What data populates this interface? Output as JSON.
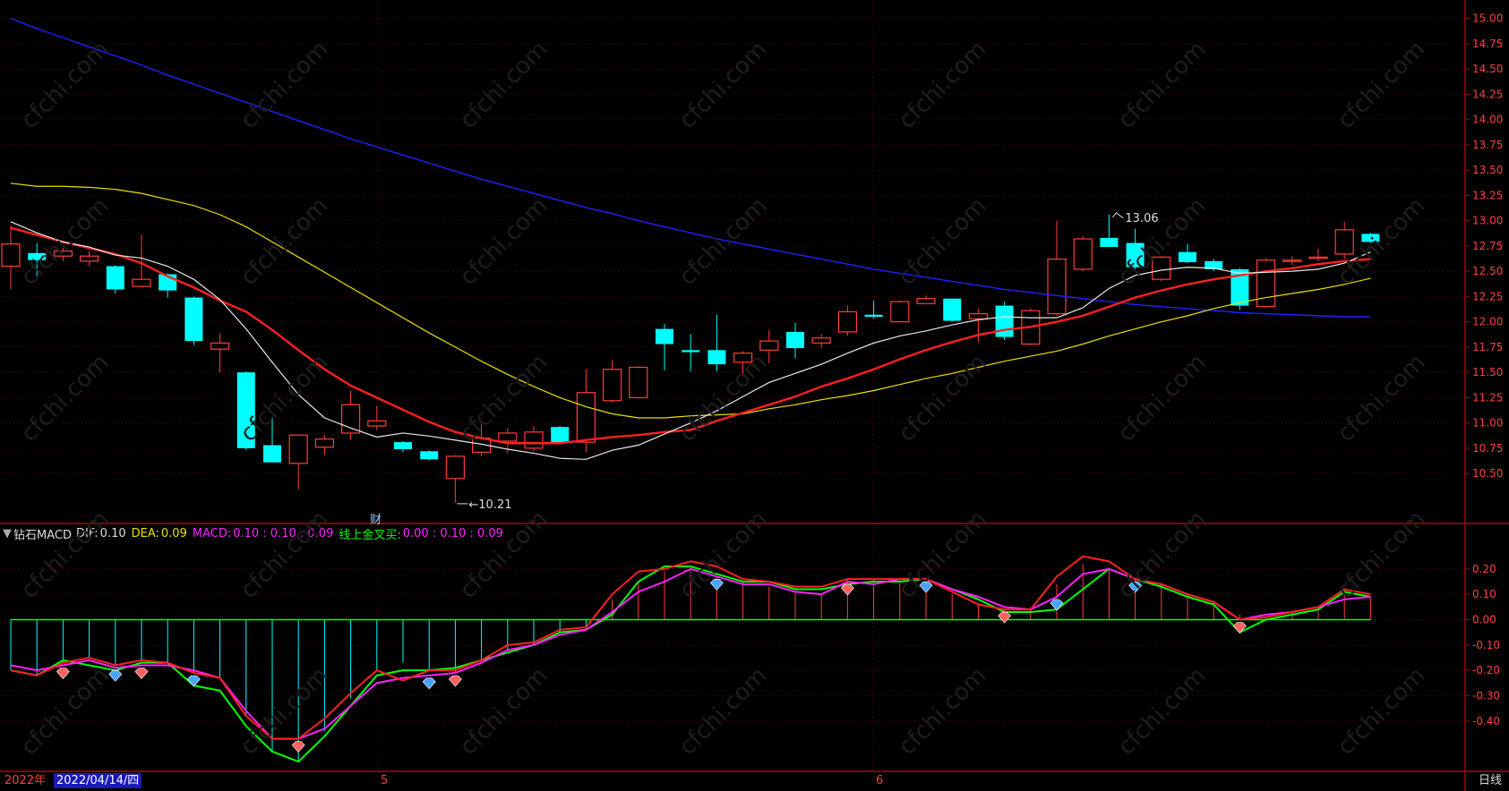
{
  "period_label": "日线",
  "year_label": "2022年",
  "cursor_date": "2022/04/14/四",
  "month_labels": [
    "5",
    "6"
  ],
  "finance_marker": "财",
  "watermark": "cfchi.com",
  "indicator": {
    "name": "钻石MACD",
    "dif_label": "DIF:",
    "dif_value": "0.10",
    "dea_label": "DEA:",
    "dea_value": "0.09",
    "macd_label": "MACD:",
    "macd_value": "0.10 : 0.10 : 0.09",
    "cross_label": "线上金叉买:",
    "cross_value": "0.00 : 0.10 : 0.09"
  },
  "colors": {
    "up": "#ff3c3c",
    "down": "#00ffff",
    "ma_fast": "#e8e8e8",
    "ma_mid": "#ff2020",
    "ma_slow": "#e8e000",
    "ma_long": "#2020ff",
    "dif": "#ff2020",
    "dea": "#ff20ff",
    "green": "#00ff00",
    "axis": "#b00000"
  },
  "chart_data": [
    {
      "type": "candlestick",
      "title": "",
      "y_ticks": [
        10.5,
        10.75,
        11.0,
        11.25,
        11.5,
        11.75,
        12.0,
        12.25,
        12.5,
        12.75,
        13.0,
        13.25,
        13.5,
        13.75,
        14.0,
        14.25,
        14.5,
        14.75,
        15.0
      ],
      "y_tick_labels": [
        "10.50",
        "10.75",
        "11.00",
        "11.25",
        "11.50",
        "11.75",
        "12.00",
        "12.25",
        "12.50",
        "12.75",
        "13.00",
        "13.25",
        "13.50",
        "13.75",
        "14.00",
        "14.25",
        "14.50",
        "14.75",
        "15.00"
      ],
      "ylim": [
        10.05,
        15.05
      ],
      "annotations": [
        {
          "text": "13.06",
          "index": 42,
          "value": 13.06
        },
        {
          "text": "10.21",
          "index": 17,
          "value": 10.21
        }
      ],
      "candles": [
        {
          "o": 12.55,
          "h": 12.95,
          "l": 12.32,
          "c": 12.77
        },
        {
          "o": 12.68,
          "h": 12.78,
          "l": 12.45,
          "c": 12.61
        },
        {
          "o": 12.65,
          "h": 12.73,
          "l": 12.6,
          "c": 12.7
        },
        {
          "o": 12.6,
          "h": 12.7,
          "l": 12.55,
          "c": 12.65
        },
        {
          "o": 12.55,
          "h": 12.56,
          "l": 12.28,
          "c": 12.32
        },
        {
          "o": 12.35,
          "h": 12.86,
          "l": 12.34,
          "c": 12.42
        },
        {
          "o": 12.47,
          "h": 12.48,
          "l": 12.24,
          "c": 12.31
        },
        {
          "o": 12.24,
          "h": 12.25,
          "l": 11.77,
          "c": 11.81
        },
        {
          "o": 11.73,
          "h": 11.89,
          "l": 11.5,
          "c": 11.79
        },
        {
          "o": 11.5,
          "h": 11.51,
          "l": 10.73,
          "c": 10.75
        },
        {
          "o": 10.78,
          "h": 11.05,
          "l": 10.61,
          "c": 10.61
        },
        {
          "o": 10.6,
          "h": 10.88,
          "l": 10.34,
          "c": 10.88
        },
        {
          "o": 10.76,
          "h": 10.88,
          "l": 10.68,
          "c": 10.84
        },
        {
          "o": 10.9,
          "h": 11.32,
          "l": 10.83,
          "c": 11.18
        },
        {
          "o": 10.97,
          "h": 11.17,
          "l": 10.93,
          "c": 11.02
        },
        {
          "o": 10.81,
          "h": 10.82,
          "l": 10.71,
          "c": 10.74
        },
        {
          "o": 10.72,
          "h": 10.73,
          "l": 10.63,
          "c": 10.64
        },
        {
          "o": 10.45,
          "h": 10.68,
          "l": 10.21,
          "c": 10.67
        },
        {
          "o": 10.71,
          "h": 10.99,
          "l": 10.67,
          "c": 10.85
        },
        {
          "o": 10.82,
          "h": 10.95,
          "l": 10.7,
          "c": 10.9
        },
        {
          "o": 10.75,
          "h": 10.97,
          "l": 10.72,
          "c": 10.91
        },
        {
          "o": 10.96,
          "h": 10.97,
          "l": 10.79,
          "c": 10.8
        },
        {
          "o": 10.81,
          "h": 11.53,
          "l": 10.71,
          "c": 11.3
        },
        {
          "o": 11.22,
          "h": 11.62,
          "l": 11.2,
          "c": 11.53
        },
        {
          "o": 11.25,
          "h": 11.56,
          "l": 11.24,
          "c": 11.55
        },
        {
          "o": 11.93,
          "h": 11.98,
          "l": 11.52,
          "c": 11.78
        },
        {
          "o": 11.72,
          "h": 11.88,
          "l": 11.51,
          "c": 11.7
        },
        {
          "o": 11.72,
          "h": 12.07,
          "l": 11.51,
          "c": 11.58
        },
        {
          "o": 11.6,
          "h": 11.71,
          "l": 11.47,
          "c": 11.69
        },
        {
          "o": 11.72,
          "h": 11.92,
          "l": 11.59,
          "c": 11.81
        },
        {
          "o": 11.9,
          "h": 11.99,
          "l": 11.64,
          "c": 11.74
        },
        {
          "o": 11.79,
          "h": 11.88,
          "l": 11.74,
          "c": 11.84
        },
        {
          "o": 11.9,
          "h": 12.16,
          "l": 11.86,
          "c": 12.1
        },
        {
          "o": 12.07,
          "h": 12.21,
          "l": 12.03,
          "c": 12.05
        },
        {
          "o": 12.0,
          "h": 12.21,
          "l": 12.0,
          "c": 12.2
        },
        {
          "o": 12.18,
          "h": 12.26,
          "l": 12.18,
          "c": 12.23
        },
        {
          "o": 12.23,
          "h": 12.23,
          "l": 12.0,
          "c": 12.01
        },
        {
          "o": 12.03,
          "h": 12.13,
          "l": 11.8,
          "c": 12.08
        },
        {
          "o": 12.16,
          "h": 12.2,
          "l": 11.82,
          "c": 11.85
        },
        {
          "o": 11.78,
          "h": 12.13,
          "l": 11.77,
          "c": 12.11
        },
        {
          "o": 12.08,
          "h": 13.0,
          "l": 12.06,
          "c": 12.62
        },
        {
          "o": 12.52,
          "h": 12.85,
          "l": 12.5,
          "c": 12.82
        },
        {
          "o": 12.83,
          "h": 13.06,
          "l": 12.74,
          "c": 12.74
        },
        {
          "o": 12.78,
          "h": 12.92,
          "l": 12.52,
          "c": 12.54
        },
        {
          "o": 12.42,
          "h": 12.65,
          "l": 12.4,
          "c": 12.64
        },
        {
          "o": 12.69,
          "h": 12.77,
          "l": 12.58,
          "c": 12.59
        },
        {
          "o": 12.6,
          "h": 12.62,
          "l": 12.5,
          "c": 12.52
        },
        {
          "o": 12.52,
          "h": 12.53,
          "l": 12.12,
          "c": 12.16
        },
        {
          "o": 12.15,
          "h": 12.63,
          "l": 12.14,
          "c": 12.61
        },
        {
          "o": 12.6,
          "h": 12.65,
          "l": 12.56,
          "c": 12.61
        },
        {
          "o": 12.64,
          "h": 12.72,
          "l": 12.6,
          "c": 12.64
        },
        {
          "o": 12.67,
          "h": 12.99,
          "l": 12.62,
          "c": 12.91
        },
        {
          "o": 12.87,
          "h": 12.88,
          "l": 12.78,
          "c": 12.79
        }
      ],
      "ma_fast": [
        12.99,
        12.88,
        12.79,
        12.74,
        12.66,
        12.63,
        12.55,
        12.42,
        12.22,
        11.93,
        11.6,
        11.28,
        11.05,
        10.95,
        10.86,
        10.9,
        10.87,
        10.83,
        10.79,
        10.74,
        10.7,
        10.65,
        10.64,
        10.73,
        10.78,
        10.89,
        11.0,
        11.12,
        11.26,
        11.4,
        11.49,
        11.58,
        11.69,
        11.79,
        11.86,
        11.91,
        11.97,
        12.02,
        12.05,
        12.04,
        12.04,
        12.14,
        12.33,
        12.46,
        12.51,
        12.54,
        12.53,
        12.48,
        12.49,
        12.5,
        12.52,
        12.58,
        12.69
      ],
      "ma_mid": [
        12.93,
        12.86,
        12.79,
        12.73,
        12.67,
        12.58,
        12.45,
        12.34,
        12.21,
        12.1,
        11.92,
        11.72,
        11.53,
        11.37,
        11.25,
        11.13,
        11.01,
        10.91,
        10.85,
        10.8,
        10.8,
        10.8,
        10.83,
        10.86,
        10.88,
        10.91,
        10.93,
        11.02,
        11.1,
        11.18,
        11.26,
        11.36,
        11.44,
        11.53,
        11.63,
        11.72,
        11.8,
        11.87,
        11.92,
        11.95,
        12.0,
        12.06,
        12.15,
        12.24,
        12.31,
        12.37,
        12.42,
        12.46,
        12.5,
        12.53,
        12.57,
        12.6,
        12.62
      ],
      "ma_slow": [
        13.37,
        13.34,
        13.34,
        13.33,
        13.31,
        13.27,
        13.21,
        13.15,
        13.06,
        12.94,
        12.79,
        12.64,
        12.49,
        12.34,
        12.19,
        12.04,
        11.89,
        11.75,
        11.61,
        11.48,
        11.36,
        11.25,
        11.16,
        11.09,
        11.05,
        11.05,
        11.07,
        11.08,
        11.09,
        11.14,
        11.18,
        11.23,
        11.27,
        11.32,
        11.38,
        11.44,
        11.49,
        11.55,
        11.61,
        11.66,
        11.71,
        11.78,
        11.86,
        11.93,
        12.0,
        12.06,
        12.13,
        12.19,
        12.24,
        12.28,
        12.32,
        12.37,
        12.43
      ],
      "ma_long": [
        15.0,
        14.9,
        14.81,
        14.72,
        14.63,
        14.54,
        14.44,
        14.35,
        14.26,
        14.17,
        14.08,
        13.99,
        13.9,
        13.81,
        13.73,
        13.65,
        13.57,
        13.49,
        13.41,
        13.34,
        13.27,
        13.2,
        13.13,
        13.07,
        13.0,
        12.94,
        12.88,
        12.82,
        12.77,
        12.72,
        12.67,
        12.62,
        12.57,
        12.52,
        12.48,
        12.44,
        12.4,
        12.36,
        12.32,
        12.29,
        12.26,
        12.23,
        12.2,
        12.17,
        12.15,
        12.13,
        12.11,
        12.09,
        12.08,
        12.07,
        12.06,
        12.05,
        12.05
      ]
    },
    {
      "type": "macd",
      "title": "钻石MACD",
      "y_ticks": [
        0.2,
        0.1,
        0.0,
        -0.1,
        -0.2,
        -0.3,
        -0.4
      ],
      "y_tick_labels": [
        "0.20",
        "0.10",
        "0.00",
        "-0.10",
        "-0.20",
        "-0.30",
        "-0.40"
      ],
      "ylim": [
        -0.57,
        0.27
      ],
      "histogram": [
        -0.2,
        -0.22,
        -0.17,
        -0.15,
        -0.18,
        -0.16,
        -0.17,
        -0.21,
        -0.23,
        -0.38,
        -0.52,
        -0.56,
        -0.44,
        -0.31,
        -0.2,
        -0.17,
        -0.2,
        -0.21,
        -0.17,
        -0.12,
        -0.1,
        -0.05,
        -0.04,
        0.08,
        0.15,
        0.19,
        0.21,
        0.17,
        0.15,
        0.13,
        0.11,
        0.1,
        0.16,
        0.16,
        0.15,
        0.16,
        0.1,
        0.06,
        0.04,
        0.04,
        0.14,
        0.22,
        0.2,
        0.16,
        0.14,
        0.1,
        0.07,
        0.02,
        0.01,
        0.03,
        0.05,
        0.11,
        0.09
      ],
      "dif": [
        -0.2,
        -0.22,
        -0.17,
        -0.15,
        -0.18,
        -0.16,
        -0.17,
        -0.21,
        -0.23,
        -0.38,
        -0.47,
        -0.47,
        -0.39,
        -0.29,
        -0.2,
        -0.24,
        -0.2,
        -0.2,
        -0.16,
        -0.1,
        -0.09,
        -0.04,
        -0.03,
        0.1,
        0.19,
        0.2,
        0.23,
        0.21,
        0.16,
        0.15,
        0.13,
        0.13,
        0.16,
        0.16,
        0.16,
        0.16,
        0.11,
        0.06,
        0.04,
        0.04,
        0.17,
        0.25,
        0.23,
        0.16,
        0.14,
        0.1,
        0.07,
        0.0,
        0.01,
        0.03,
        0.05,
        0.12,
        0.1
      ],
      "dea": [
        -0.18,
        -0.2,
        -0.18,
        -0.16,
        -0.19,
        -0.18,
        -0.18,
        -0.2,
        -0.23,
        -0.36,
        -0.47,
        -0.47,
        -0.43,
        -0.34,
        -0.25,
        -0.23,
        -0.22,
        -0.21,
        -0.17,
        -0.12,
        -0.1,
        -0.06,
        -0.04,
        0.03,
        0.11,
        0.15,
        0.2,
        0.17,
        0.14,
        0.14,
        0.11,
        0.1,
        0.15,
        0.14,
        0.16,
        0.16,
        0.12,
        0.09,
        0.05,
        0.04,
        0.09,
        0.18,
        0.2,
        0.16,
        0.14,
        0.1,
        0.07,
        0.0,
        0.02,
        0.03,
        0.05,
        0.08,
        0.09
      ],
      "green_line": [
        -0.2,
        -0.22,
        -0.16,
        -0.18,
        -0.2,
        -0.17,
        -0.17,
        -0.26,
        -0.28,
        -0.42,
        -0.52,
        -0.56,
        -0.46,
        -0.34,
        -0.22,
        -0.2,
        -0.2,
        -0.19,
        -0.16,
        -0.13,
        -0.1,
        -0.05,
        -0.04,
        0.02,
        0.15,
        0.21,
        0.21,
        0.18,
        0.15,
        0.15,
        0.12,
        0.12,
        0.14,
        0.15,
        0.15,
        0.16,
        0.12,
        0.08,
        0.03,
        0.03,
        0.04,
        0.12,
        0.2,
        0.16,
        0.13,
        0.09,
        0.06,
        -0.05,
        0.0,
        0.02,
        0.04,
        0.11,
        0.09
      ],
      "buy_markers": [
        2,
        5,
        16,
        17,
        11,
        32,
        38,
        47
      ],
      "sell_markers": [
        4,
        7,
        16,
        27,
        35,
        40,
        43
      ]
    }
  ]
}
